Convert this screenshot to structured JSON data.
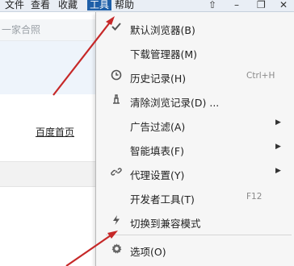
{
  "menubar": {
    "items": [
      "文件",
      "查看",
      "收藏",
      "工具",
      "帮助"
    ],
    "window_controls": [
      "⇧",
      "–",
      "❐",
      "✕"
    ]
  },
  "page": {
    "family_text": "一家合照",
    "home_link": "百度首页"
  },
  "tools_menu": {
    "items": [
      {
        "label": "默认浏览器(B)",
        "icon": "check-icon"
      },
      {
        "label": "下载管理器(M)"
      },
      {
        "label": "历史记录(H)",
        "icon": "clock-icon",
        "shortcut": "Ctrl+H"
      },
      {
        "label": "清除浏览记录(D) ...",
        "icon": "clear-icon"
      },
      {
        "label": "广告过滤(A)",
        "submenu": true
      },
      {
        "label": "智能填表(F)",
        "submenu": true
      },
      {
        "label": "代理设置(Y)",
        "icon": "link-icon",
        "submenu": true
      },
      {
        "label": "开发者工具(T)",
        "shortcut": "F12"
      },
      {
        "label": "切换到兼容模式",
        "icon": "lightning-icon"
      },
      {
        "label": "选项(O)",
        "icon": "gear-icon"
      }
    ]
  },
  "colors": {
    "active_menu_bg": "#1e5fa8",
    "arrow": "#c62828"
  }
}
